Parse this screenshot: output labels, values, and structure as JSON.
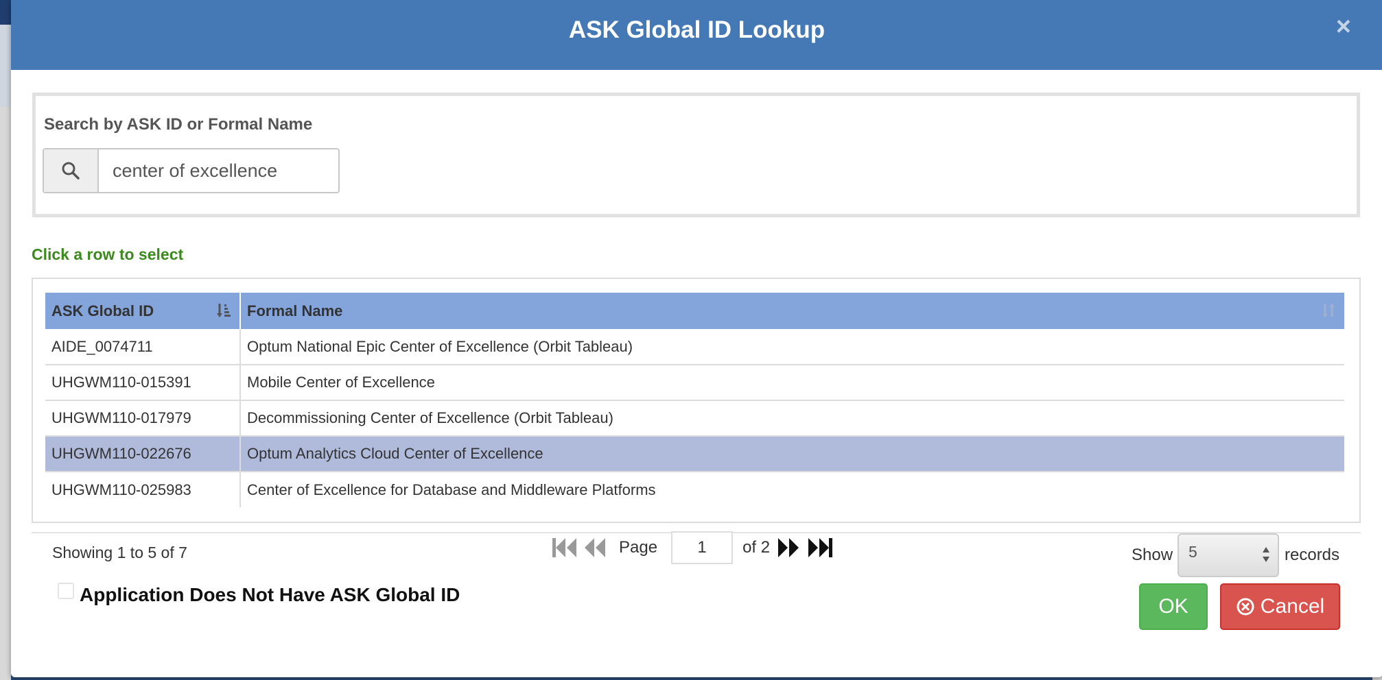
{
  "dialog": {
    "title": "ASK Global ID Lookup",
    "close_glyph": "×"
  },
  "search": {
    "label": "Search by ASK ID or Formal Name",
    "value": "center of excellence",
    "icon": "search-icon"
  },
  "hint": "Click a row to select",
  "table": {
    "columns": [
      "ASK Global ID",
      "Formal Name"
    ],
    "rows": [
      {
        "id": "AIDE_0074711",
        "name": "Optum National Epic Center of Excellence (Orbit Tableau)",
        "selected": false
      },
      {
        "id": "UHGWM110-015391",
        "name": "Mobile Center of Excellence",
        "selected": false
      },
      {
        "id": "UHGWM110-017979",
        "name": "Decommissioning Center of Excellence (Orbit Tableau)",
        "selected": false
      },
      {
        "id": "UHGWM110-022676",
        "name": "Optum Analytics Cloud Center of Excellence",
        "selected": true
      },
      {
        "id": "UHGWM110-025983",
        "name": "Center of Excellence for Database and Middleware Platforms",
        "selected": false
      }
    ]
  },
  "pagination": {
    "showing": "Showing 1 to 5 of 7",
    "page_label": "Page",
    "current_page": "1",
    "of_label": "of 2",
    "show_label": "Show",
    "records_per_page": "5",
    "records_label": "records"
  },
  "checkbox": {
    "label": "Application Does Not Have ASK Global ID",
    "checked": false
  },
  "buttons": {
    "ok": "OK",
    "cancel": "Cancel"
  },
  "colors": {
    "header": "#4479b6",
    "table_header": "#84a4dc",
    "selected_row": "#b0bbdc",
    "hint": "#3b8a1c",
    "ok": "#5cb85c",
    "cancel": "#d9534f"
  }
}
